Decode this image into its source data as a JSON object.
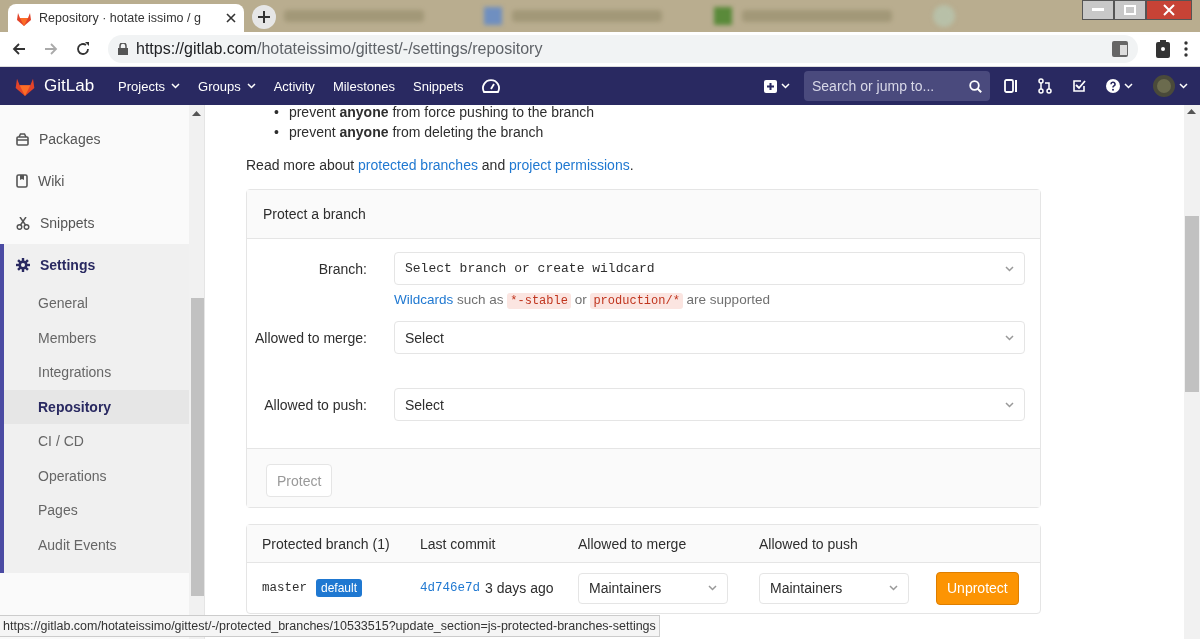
{
  "browser": {
    "tabs": [
      {
        "title": "Repository · hotate issimo / g",
        "selected": true
      }
    ],
    "url_host": "https://gitlab.com",
    "url_path": "/hotateissimo/gittest/-/settings/repository"
  },
  "navbar": {
    "logo": "GitLab",
    "menus": [
      {
        "label": "Projects",
        "dropdown": true
      },
      {
        "label": "Groups",
        "dropdown": true
      },
      {
        "label": "Activity",
        "dropdown": false
      },
      {
        "label": "Milestones",
        "dropdown": false
      },
      {
        "label": "Snippets",
        "dropdown": false
      }
    ],
    "search": {
      "placeholder": "Search or jump to..."
    }
  },
  "sidebar": {
    "items": [
      {
        "label": "Packages",
        "selected": false
      },
      {
        "label": "Wiki",
        "selected": false
      },
      {
        "label": "Snippets",
        "selected": false
      },
      {
        "label": "Settings",
        "selected": true,
        "children": [
          {
            "label": "General",
            "selected": false
          },
          {
            "label": "Members",
            "selected": false
          },
          {
            "label": "Integrations",
            "selected": false
          },
          {
            "label": "Repository",
            "selected": true
          },
          {
            "label": "CI / CD",
            "selected": false
          },
          {
            "label": "Operations",
            "selected": false
          },
          {
            "label": "Pages",
            "selected": false
          },
          {
            "label": "Audit Events",
            "selected": false
          }
        ]
      }
    ]
  },
  "content": {
    "bullets": [
      {
        "marker": "•",
        "text": "prevent **anyone** from force pushing to the branch"
      },
      {
        "marker": "•",
        "text": "prevent **anyone** from deleting the branch"
      }
    ],
    "read_more": [
      {
        "text": "Read more about ",
        "link": false
      },
      {
        "text": "protected branches",
        "link": true
      },
      {
        "text": " and ",
        "link": false
      },
      {
        "text": "project permissions",
        "link": true
      },
      {
        "text": ".",
        "link": false
      }
    ]
  },
  "protect_form": {
    "title": "Protect a branch",
    "fields": [
      {
        "label": "Branch:",
        "value": "Select branch or create wildcard",
        "kind": "mono",
        "hint": [
          {
            "text": "Wildcards",
            "kind": "link"
          },
          {
            "text": " such as ",
            "kind": "text"
          },
          {
            "text": "*-stable",
            "kind": "code"
          },
          {
            "text": " or ",
            "kind": "text"
          },
          {
            "text": "production/*",
            "kind": "code"
          },
          {
            "text": " are supported",
            "kind": "text"
          }
        ]
      },
      {
        "label": "Allowed to merge:",
        "value": "Select",
        "kind": "plain"
      },
      {
        "label": "Allowed to push:",
        "value": "Select",
        "kind": "plain"
      }
    ],
    "button": {
      "label": "Protect",
      "disabled": true
    }
  },
  "table": {
    "columns": [
      "Protected branch (1)",
      "Last commit",
      "Allowed to merge",
      "Allowed to push"
    ],
    "rows": [
      {
        "branch": "master",
        "badge": "default",
        "commit": "4d746e7d",
        "when": "3 days ago",
        "merge": "Maintainers",
        "push": "Maintainers",
        "action": "Unprotect"
      }
    ]
  },
  "status_url": "https://gitlab.com/hotateissimo/gittest/-/protected_branches/10533515?update_section=js-protected-branches-settings"
}
